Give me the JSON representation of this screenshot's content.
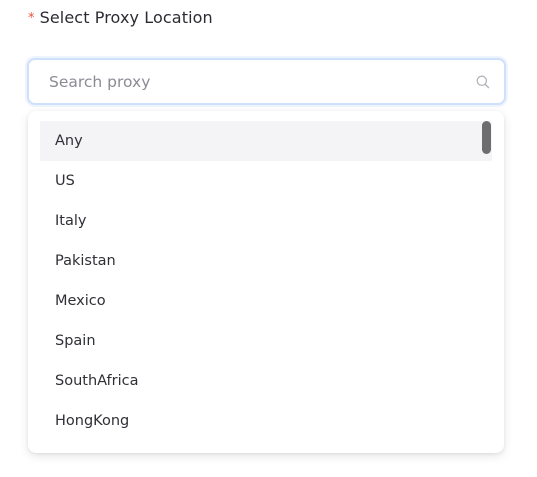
{
  "field": {
    "required_mark": "*",
    "label": "Select Proxy Location"
  },
  "search": {
    "placeholder": "Search proxy",
    "value": "",
    "icon": "search-icon"
  },
  "dropdown": {
    "options": [
      "Any",
      "US",
      "Italy",
      "Pakistan",
      "Mexico",
      "Spain",
      "SouthAfrica",
      "HongKong"
    ],
    "highlighted": "Any"
  },
  "colors": {
    "required_mark": "#e8553e",
    "input_border_focus": "#cfe0fb",
    "highlight_row": "#f4f4f6",
    "scrollbar_thumb": "#6d6d70"
  }
}
